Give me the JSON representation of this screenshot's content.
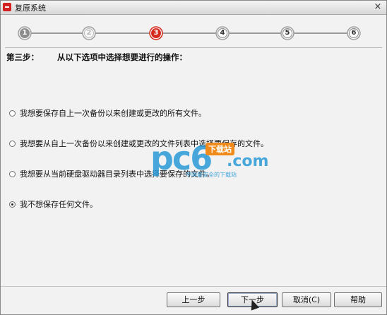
{
  "window": {
    "title": "复原系统",
    "close_glyph": "×"
  },
  "steps": [
    {
      "label": "1",
      "state": "done"
    },
    {
      "label": "2",
      "state": "done-ring"
    },
    {
      "label": "3",
      "state": "current"
    },
    {
      "label": "4",
      "state": "upcoming"
    },
    {
      "label": "5",
      "state": "upcoming"
    },
    {
      "label": "6",
      "state": "upcoming"
    }
  ],
  "heading": {
    "prefix": "第三步：",
    "text": "从以下选项中选择想要进行的操作："
  },
  "options": [
    {
      "label": "我想要保存自上一次备份以来创建或更改的所有文件。",
      "checked": false
    },
    {
      "label": "我想要从自上一次备份以来创建或更改的文件列表中选择要保存的文件。",
      "checked": false
    },
    {
      "label": "我想要从当前硬盘驱动器目录列表中选择要保存的文件。",
      "checked": false
    },
    {
      "label": "我不想保存任何文件。",
      "checked": true
    }
  ],
  "watermark": {
    "brand": "pc6",
    "domain": ".com",
    "badge": "下载站",
    "tagline": "中国最安全的下载站"
  },
  "buttons": {
    "back": "上一步",
    "next": "下一步",
    "cancel": "取消(C)",
    "help": "帮助"
  },
  "colors": {
    "current_step": "#d62a1e",
    "step_gray": "#8c8c8c",
    "step_track": "#9a9a9a",
    "watermark_blue": "#2a9ad8",
    "watermark_orange": "#f08a1a"
  }
}
